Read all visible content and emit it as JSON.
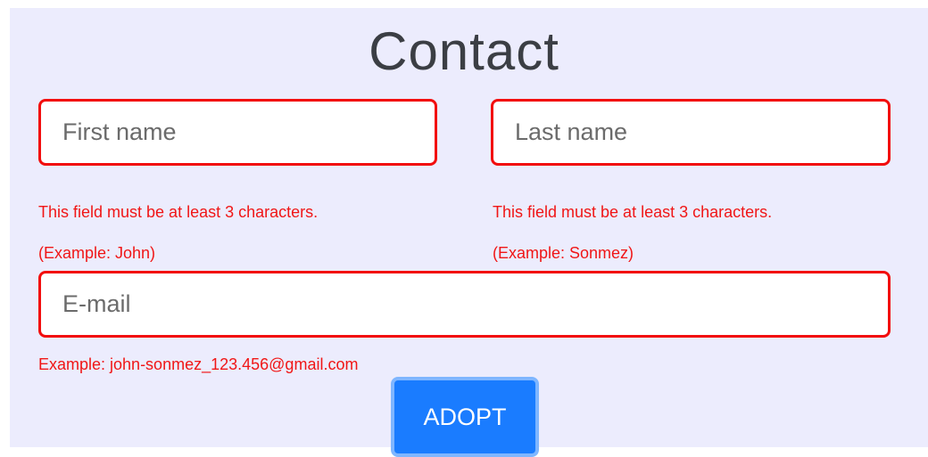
{
  "form": {
    "title": "Contact",
    "first_name": {
      "value": "",
      "placeholder": "First name",
      "error_rule": "This field must be at least 3 characters.",
      "error_example": "(Example: John)"
    },
    "last_name": {
      "value": "",
      "placeholder": "Last name",
      "error_rule": "This field must be at least 3 characters.",
      "error_example": "(Example: Sonmez)"
    },
    "email": {
      "value": "",
      "placeholder": "E-mail",
      "error_example": "Example: john-sonmez_123.456@gmail.com"
    },
    "submit_label": "ADOPT"
  },
  "colors": {
    "background": "#ececfd",
    "error": "#f01616",
    "field_border_error": "#f20d0d",
    "button": "#1a7cff",
    "button_focus_ring": "#7fb6ff",
    "title": "#3b3e44"
  }
}
